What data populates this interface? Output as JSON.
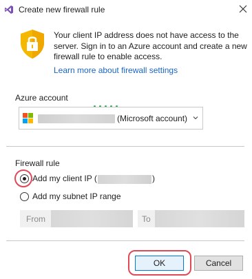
{
  "window": {
    "title": "Create new firewall rule",
    "app_icon": "visual-studio-icon",
    "close_icon": "close-icon"
  },
  "info": {
    "icon": "shield-lock-icon",
    "message": "Your client IP address does not have access to the server. Sign in to an Azure account and create a new firewall rule to enable access.",
    "link": "Learn more about firewall settings"
  },
  "azure_account": {
    "label": "Azure account",
    "selected_suffix": "(Microsoft account)",
    "icon": "microsoft-logo-icon",
    "chevron": "chevron-down-icon"
  },
  "firewall_rule": {
    "label": "Firewall rule",
    "options": [
      {
        "label": "Add my client IP (",
        "close": ")",
        "selected": true
      },
      {
        "label": "Add my subnet IP range",
        "selected": false
      }
    ],
    "from_label": "From",
    "to_label": "To"
  },
  "buttons": {
    "ok": "OK",
    "cancel": "Cancel"
  },
  "colors": {
    "link": "#1a65c2",
    "highlight": "#e04857",
    "shield": "#f5b800",
    "primary_border": "#0078d7"
  }
}
